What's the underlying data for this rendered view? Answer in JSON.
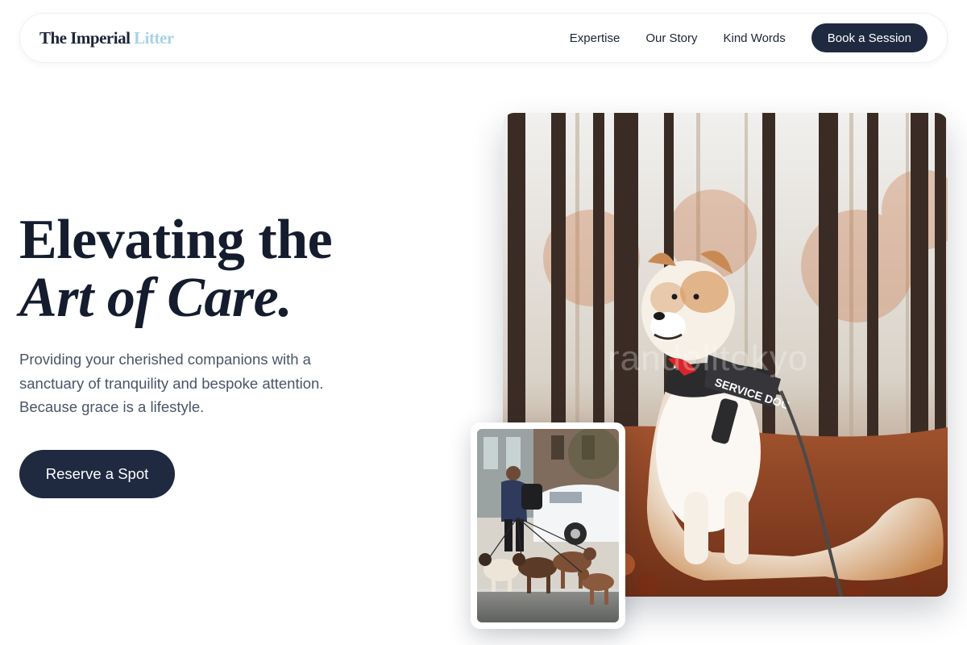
{
  "brand": {
    "name_primary": "The Imperial",
    "name_accent": "Litter",
    "accent_color": "#a9d3e4"
  },
  "nav": {
    "links": [
      "Expertise",
      "Our Story",
      "Kind Words"
    ],
    "cta_label": "Book a Session"
  },
  "hero": {
    "title_line1": "Elevating the",
    "title_line2": "Art of Care.",
    "subtitle": "Providing your cherished companions with a sanctuary of tranquility and bespoke attention. Because grace is a lifestyle.",
    "cta_label": "Reserve a Spot"
  },
  "images": {
    "main": {
      "subject": "service dog in autumn forest",
      "harness_text": "SERVICE DOG",
      "watermark": "randolltokyo"
    },
    "secondary": {
      "subject": "dog walker with a pack of dogs on a city street"
    }
  },
  "colors": {
    "primary_dark": "#1f2a40",
    "text_muted": "#4a5568"
  }
}
